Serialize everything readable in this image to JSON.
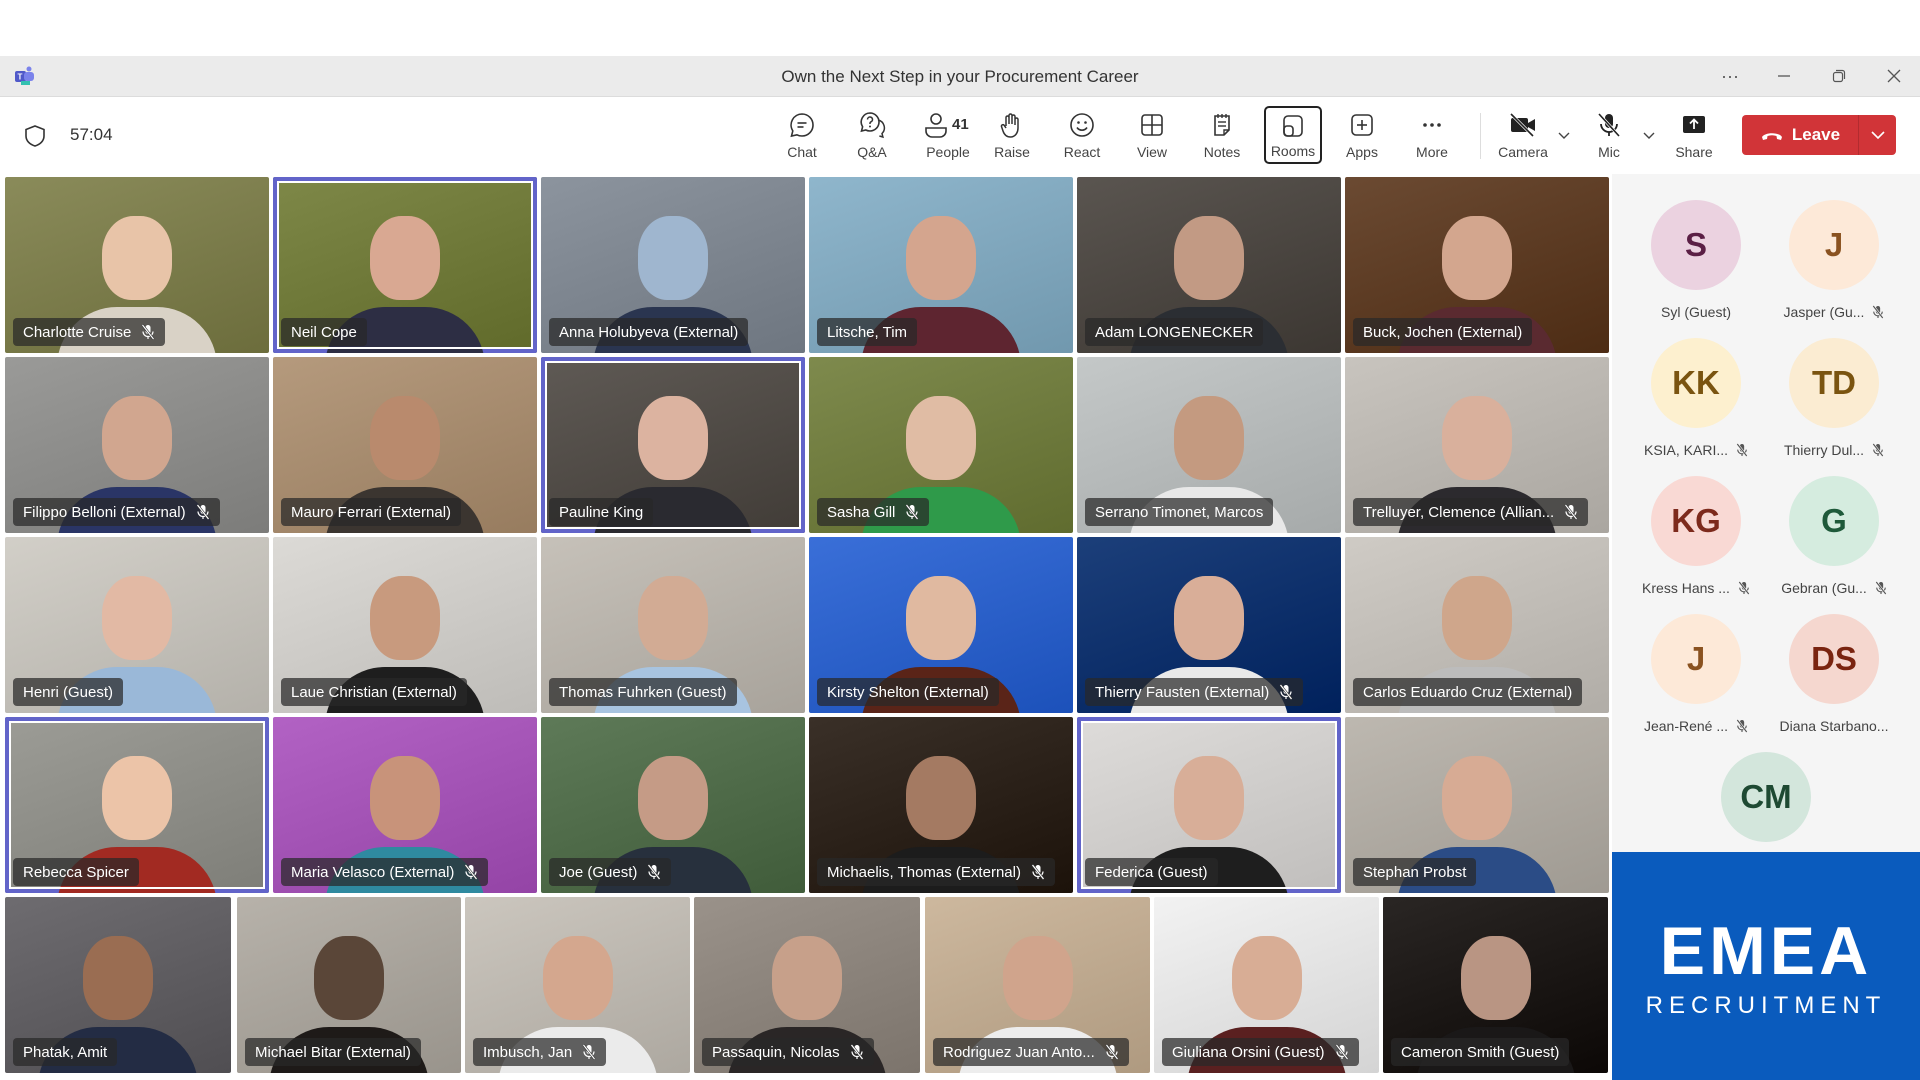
{
  "window": {
    "title": "Own the Next Step in your Procurement Career",
    "controls": [
      "more-options",
      "minimize",
      "restore",
      "close"
    ]
  },
  "meeting": {
    "timer": "57:04",
    "participant_count": "41"
  },
  "toolbar": {
    "chat": "Chat",
    "qa": "Q&A",
    "people": "People",
    "raise": "Raise",
    "react": "React",
    "view": "View",
    "notes": "Notes",
    "rooms": "Rooms",
    "apps": "Apps",
    "more": "More",
    "camera": "Camera",
    "mic": "Mic",
    "share": "Share",
    "leave": "Leave"
  },
  "colors": {
    "leave": "#d13438",
    "active_speaker": "#6264c9",
    "brand_block": "#0a5bbd"
  },
  "tiles": [
    {
      "name": "Charlotte Cruise",
      "muted": true,
      "active": false,
      "bg": "#8a8b5a",
      "skin": "#e8c4a8",
      "shirt": "#d9d2c6"
    },
    {
      "name": "Neil Cope",
      "muted": false,
      "active": true,
      "bg": "#7e8848",
      "skin": "#d9a892",
      "shirt": "#2d2e44"
    },
    {
      "name": "Anna Holubyeva (External)",
      "muted": false,
      "active": false,
      "bg": "#8c949e",
      "skin": "#9fb6cf",
      "shirt": "#2a3550"
    },
    {
      "name": "Litsche, Tim",
      "muted": false,
      "active": false,
      "bg": "#8fb6cc",
      "skin": "#d4a58e",
      "shirt": "#5e2530"
    },
    {
      "name": "Adam LONGENECKER",
      "muted": false,
      "active": false,
      "bg": "#5a5550",
      "skin": "#c29a84",
      "shirt": "#2b2e33"
    },
    {
      "name": "Buck, Jochen (External)",
      "muted": false,
      "active": false,
      "bg": "#6b4a32",
      "skin": "#d3a68e",
      "shirt": "#5a2a30"
    },
    {
      "name": "Filippo Belloni (External)",
      "muted": true,
      "active": false,
      "bg": "#9a9a98",
      "skin": "#d1a68f",
      "shirt": "#2a3566"
    },
    {
      "name": "Mauro Ferrari (External)",
      "muted": false,
      "active": false,
      "bg": "#b59a7d",
      "skin": "#b98a6d",
      "shirt": "#3b3530"
    },
    {
      "name": "Pauline King",
      "muted": false,
      "active": true,
      "bg": "#5f5a55",
      "skin": "#dcb3a0",
      "shirt": "#2a2a30"
    },
    {
      "name": "Sasha Gill",
      "muted": true,
      "active": false,
      "bg": "#7e8a4d",
      "skin": "#e0bca4",
      "shirt": "#2f9a4a"
    },
    {
      "name": "Serrano Timonet, Marcos",
      "muted": false,
      "active": false,
      "bg": "#c4c8c8",
      "skin": "#c49a80",
      "shirt": "#e8e8e8"
    },
    {
      "name": "Trelluyer, Clemence (Allian...",
      "muted": true,
      "active": false,
      "bg": "#c8c4be",
      "skin": "#d9b09c",
      "shirt": "#2c2a2e"
    },
    {
      "name": "Henri (Guest)",
      "muted": false,
      "active": false,
      "bg": "#d2cfc8",
      "skin": "#e2b9a4",
      "shirt": "#9ab8d8"
    },
    {
      "name": "Laue Christian (External)",
      "muted": false,
      "active": false,
      "bg": "#dcdad6",
      "skin": "#c89a7e",
      "shirt": "#1e1e1e"
    },
    {
      "name": "Thomas Fuhrken (Guest)",
      "muted": false,
      "active": false,
      "bg": "#c6c1b9",
      "skin": "#d2ab94",
      "shirt": "#a8c4e0"
    },
    {
      "name": "Kirsty Shelton (External)",
      "muted": false,
      "active": false,
      "bg": "#3a6fd8",
      "skin": "#e0b9a0",
      "shirt": "#5a2418"
    },
    {
      "name": "Thierry Fausten (External)",
      "muted": true,
      "active": false,
      "bg": "#1c3f7a",
      "skin": "#d9ae98",
      "shirt": "#e9e9e9"
    },
    {
      "name": "Carlos Eduardo Cruz (External)",
      "muted": false,
      "active": false,
      "bg": "#cfcbc5",
      "skin": "#cfa68b",
      "shirt": "#bcbcbc"
    },
    {
      "name": "Rebecca Spicer",
      "muted": false,
      "active": true,
      "bg": "#9c9c96",
      "skin": "#ecc4a8",
      "shirt": "#a22a22"
    },
    {
      "name": "Maria Velasco (External)",
      "muted": true,
      "active": false,
      "bg": "#b262c4",
      "skin": "#c8937a",
      "shirt": "#2f8aa0"
    },
    {
      "name": "Joe (Guest)",
      "muted": true,
      "active": false,
      "bg": "#5e7a58",
      "skin": "#c59b86",
      "shirt": "#27303d"
    },
    {
      "name": "Michaelis, Thomas (External)",
      "muted": true,
      "active": false,
      "bg": "#3a3028",
      "skin": "#a47a62",
      "shirt": "#1c1c1c"
    },
    {
      "name": "Federica (Guest)",
      "muted": false,
      "active": true,
      "bg": "#dedcda",
      "skin": "#d8ae98",
      "shirt": "#1e1e1e"
    },
    {
      "name": "Stephan Probst",
      "muted": false,
      "active": false,
      "bg": "#bdb8b0",
      "skin": "#d7ab94",
      "shirt": "#2b4c86"
    },
    {
      "name": "Phatak, Amit",
      "muted": false,
      "active": false,
      "bg": "#6e6c70",
      "skin": "#9a6d52",
      "shirt": "#232c44"
    },
    {
      "name": "Michael Bitar (External)",
      "muted": false,
      "active": false,
      "bg": "#b7b2aa",
      "skin": "#5a4638",
      "shirt": "#1e1a18"
    },
    {
      "name": "Imbusch, Jan",
      "muted": true,
      "active": false,
      "bg": "#cbc6be",
      "skin": "#d4a78e",
      "shirt": "#ebebeb"
    },
    {
      "name": "Passaquin, Nicolas",
      "muted": true,
      "active": false,
      "bg": "#9a928a",
      "skin": "#c7a08a",
      "shirt": "#2a2626"
    },
    {
      "name": "Rodriguez Juan Anto...",
      "muted": true,
      "active": false,
      "bg": "#cdb89e",
      "skin": "#d0a48c",
      "shirt": "#ededed"
    },
    {
      "name": "Giuliana Orsini (Guest)",
      "muted": true,
      "active": false,
      "bg": "#f2f2f2",
      "skin": "#d8ad95",
      "shirt": "#5a2020"
    },
    {
      "name": "Cameron Smith (Guest)",
      "muted": false,
      "active": false,
      "bg": "#2a2624",
      "skin": "#b99583",
      "shirt": "#1a1818"
    }
  ],
  "sidebar_participants": [
    {
      "initials": "S",
      "name": "Syl (Guest)",
      "muted": false,
      "bg": "#ebd2e0",
      "fg": "#5b1f45"
    },
    {
      "initials": "J",
      "name": "Jasper (Gu...",
      "muted": true,
      "bg": "#fde9d8",
      "fg": "#8a5220"
    },
    {
      "initials": "KK",
      "name": "KSIA, KARI...",
      "muted": true,
      "bg": "#fdf0cf",
      "fg": "#7a5410"
    },
    {
      "initials": "TD",
      "name": "Thierry Dul...",
      "muted": true,
      "bg": "#fbecd2",
      "fg": "#7a5410"
    },
    {
      "initials": "KG",
      "name": "Kress Hans ...",
      "muted": true,
      "bg": "#f9d9d4",
      "fg": "#7d2a1c"
    },
    {
      "initials": "G",
      "name": "Gebran (Gu...",
      "muted": true,
      "bg": "#d5ecdf",
      "fg": "#1f5a3a"
    },
    {
      "initials": "J",
      "name": "Jean-René ...",
      "muted": true,
      "bg": "#fde9d8",
      "fg": "#8a5220"
    },
    {
      "initials": "DS",
      "name": "Diana Starbano...",
      "muted": false,
      "bg": "#f5d7cf",
      "fg": "#7a2410"
    },
    {
      "initials": "CM",
      "name": "",
      "muted": false,
      "bg": "#d3e6dc",
      "fg": "#1e4a33"
    }
  ],
  "brand": {
    "name": "EMEA",
    "tagline": "RECRUITMENT"
  }
}
